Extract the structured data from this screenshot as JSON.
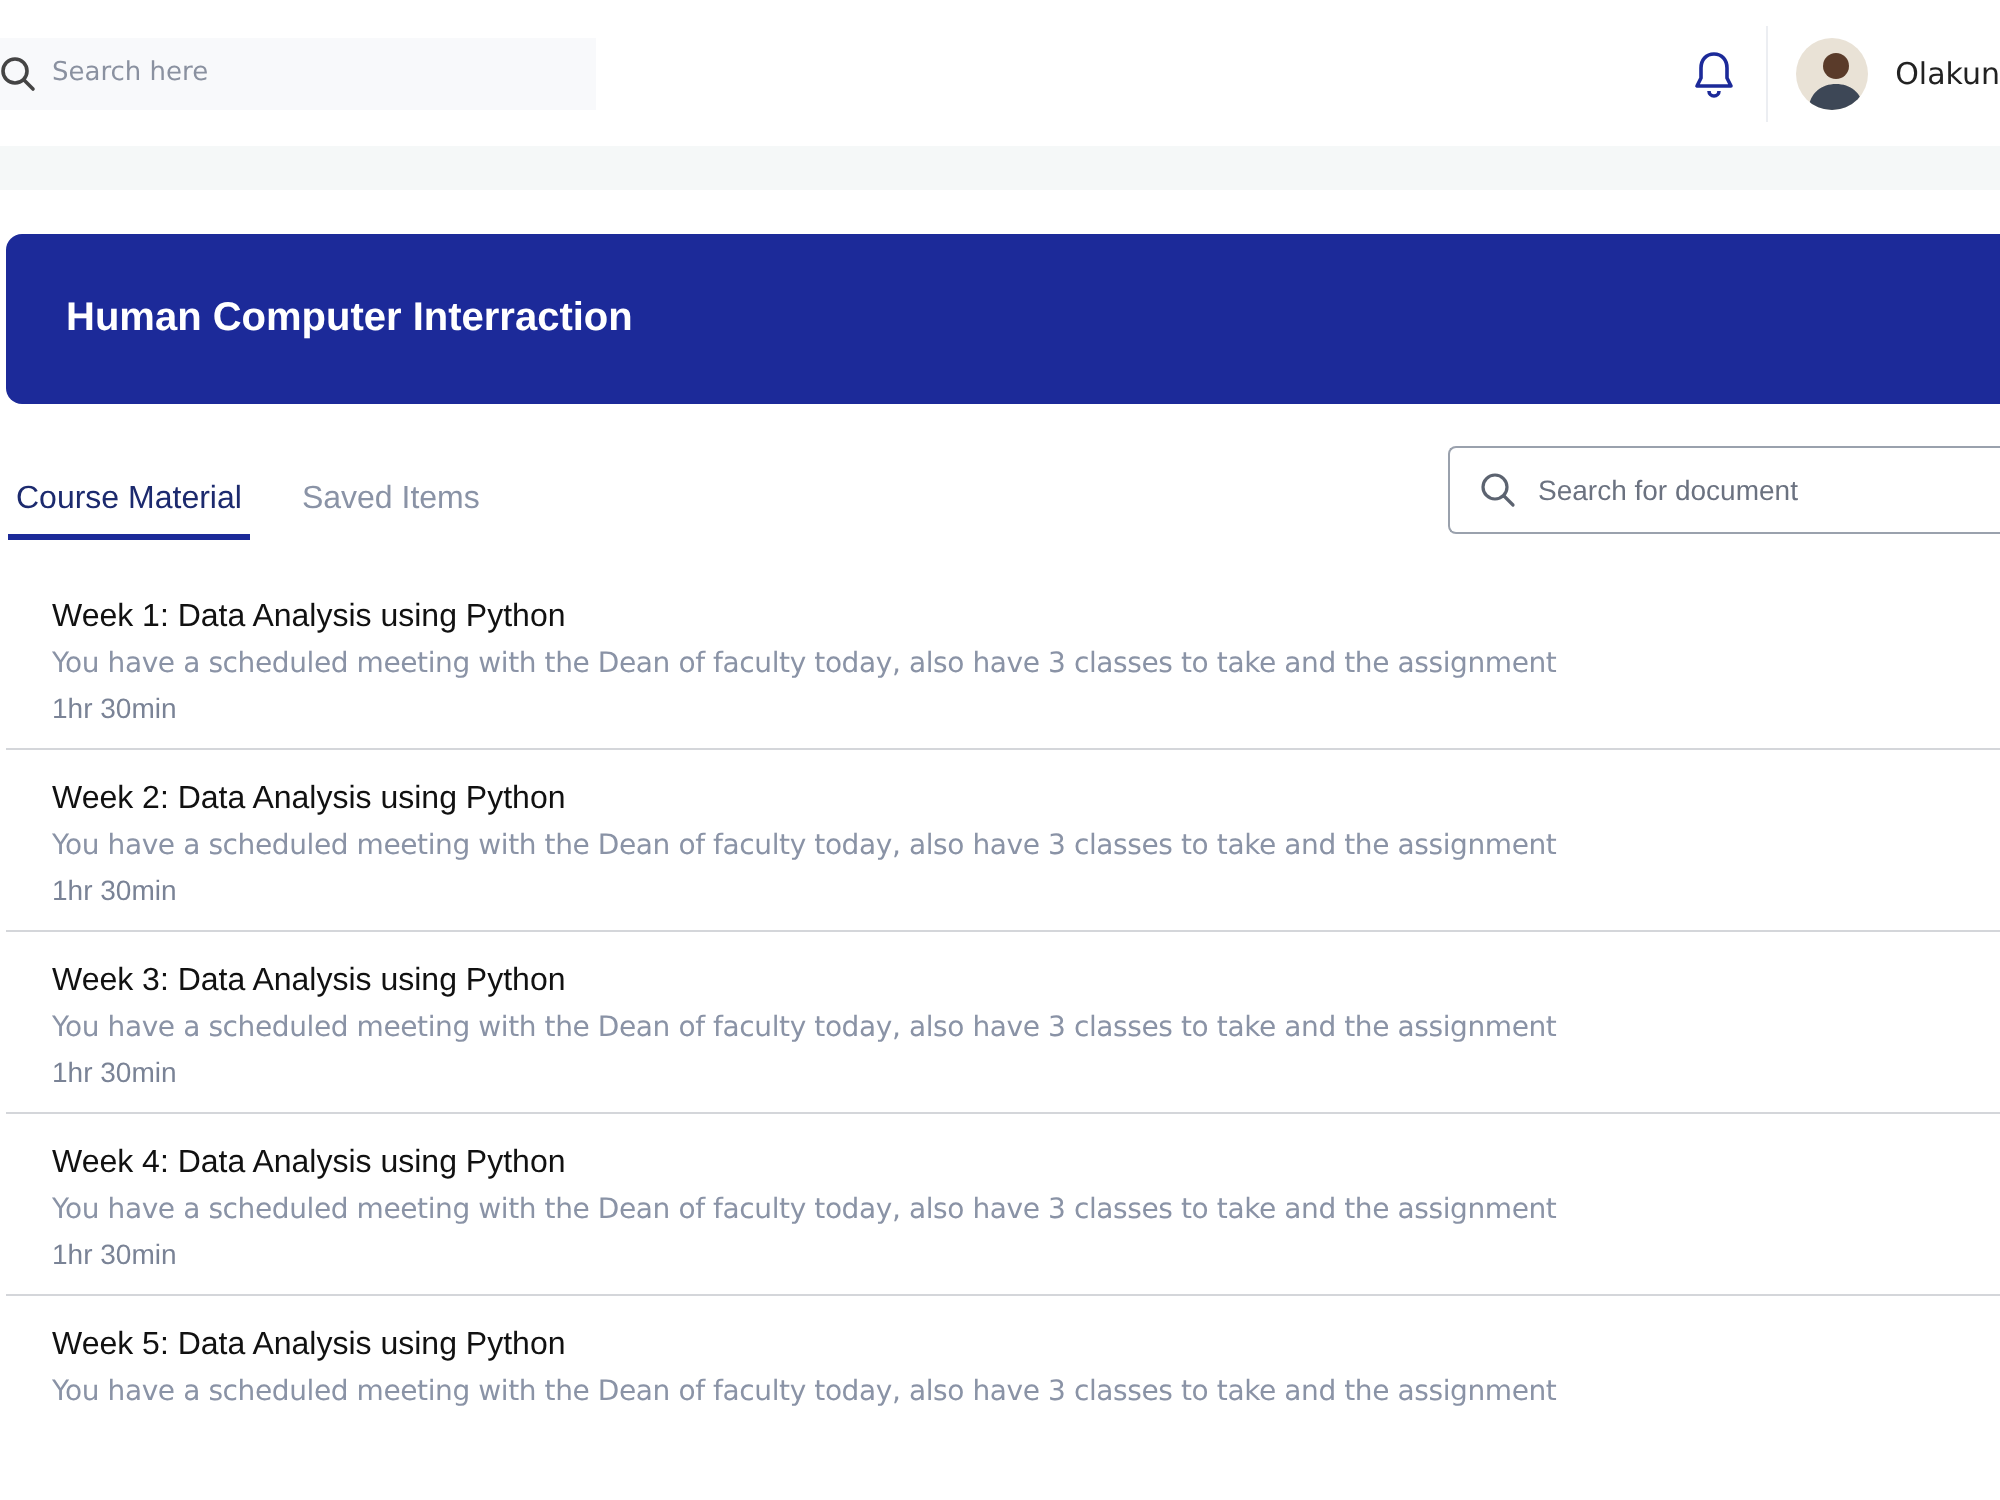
{
  "top_bar": {
    "search": {
      "placeholder": "Search here"
    },
    "user": {
      "name": "Olakun"
    }
  },
  "banner": {
    "title": "Human Computer Interraction"
  },
  "tabs": [
    {
      "label": "Course Material",
      "selected": true
    },
    {
      "label": "Saved Items",
      "selected": false
    }
  ],
  "document_search": {
    "placeholder": "Search for document"
  },
  "materials": [
    {
      "title": "Week 1: Data Analysis using Python",
      "description": "You have a scheduled meeting with the Dean of faculty today, also have 3 classes to take and the assignment",
      "duration": "1hr 30min"
    },
    {
      "title": "Week 2: Data Analysis using Python",
      "description": "You have a scheduled meeting with the Dean of faculty today, also have 3 classes to take and the assignment",
      "duration": "1hr 30min"
    },
    {
      "title": "Week 3: Data Analysis using Python",
      "description": "You have a scheduled meeting with the Dean of faculty today, also have 3 classes to take and the assignment",
      "duration": "1hr 30min"
    },
    {
      "title": "Week 4: Data Analysis using Python",
      "description": "You have a scheduled meeting with the Dean of faculty today, also have 3 classes to take and the assignment",
      "duration": "1hr 30min"
    },
    {
      "title": "Week 5: Data Analysis using Python",
      "description": "You have a scheduled meeting with the Dean of faculty today, also have 3 classes to take and the assignment"
    }
  ]
}
